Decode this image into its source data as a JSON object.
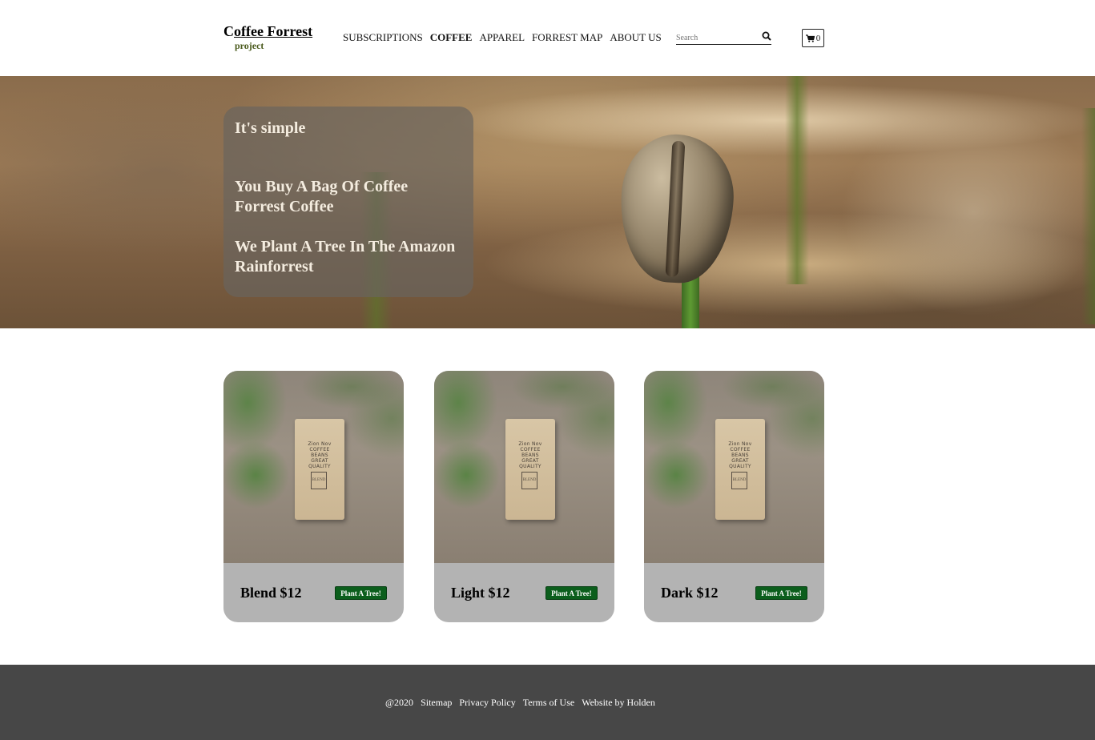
{
  "logo": {
    "title_first": "C",
    "title_rest": "offee Forrest",
    "subtitle": "project"
  },
  "nav": {
    "items": [
      {
        "label": "SUBSCRIPTIONS",
        "active": false
      },
      {
        "label": "COFFEE",
        "active": true
      },
      {
        "label": "APPAREL",
        "active": false
      },
      {
        "label": "FORREST MAP",
        "active": false
      },
      {
        "label": "ABOUT US",
        "active": false
      }
    ]
  },
  "search": {
    "placeholder": "Search",
    "icon": "search-icon"
  },
  "cart": {
    "icon": "cart-icon",
    "count": "0"
  },
  "hero": {
    "heading": "It's simple",
    "line1": "You Buy A Bag Of Coffee Forrest Coffee",
    "line2": "We Plant A Tree In The Amazon Rainforrest"
  },
  "products": [
    {
      "name": "Blend $12",
      "button": "Plant A Tree!"
    },
    {
      "name": "Light $12",
      "button": "Plant A Tree!"
    },
    {
      "name": "Dark $12",
      "button": "Plant A Tree!"
    }
  ],
  "bag_label": {
    "brand": "Zion Nov",
    "line1": "COFFEE",
    "line2": "BEANS",
    "line3": "GREAT QUALITY",
    "box": "BLEND"
  },
  "footer": {
    "copyright": "@2020",
    "links": [
      "Sitemap",
      "Privacy Policy",
      "Terms of Use",
      "Website by Holden"
    ]
  },
  "colors": {
    "plant_button": "#0b5e1c",
    "footer_bg": "#474747",
    "card_bg": "#b3b3b3",
    "logo_sub": "#4a5a1c"
  }
}
